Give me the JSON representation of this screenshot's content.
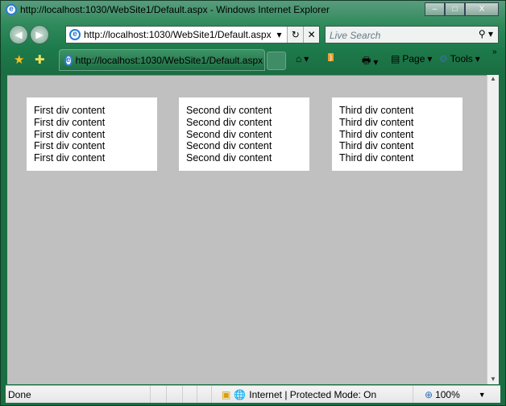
{
  "window": {
    "title": "http://localhost:1030/WebSite1/Default.aspx - Windows Internet Explorer"
  },
  "address_bar": {
    "url": "http://localhost:1030/WebSite1/Default.aspx"
  },
  "search": {
    "placeholder": "Live Search"
  },
  "tab": {
    "label": "http://localhost:1030/WebSite1/Default.aspx"
  },
  "command_bar": {
    "page_label": "Page",
    "tools_label": "Tools"
  },
  "content": {
    "divs": [
      {
        "lines": [
          "First div content",
          "First div content",
          "First div content",
          "First div content",
          "First div content"
        ]
      },
      {
        "lines": [
          "Second div content",
          "Second div content",
          "Second div content",
          "Second div content",
          "Second div content"
        ]
      },
      {
        "lines": [
          "Third div content",
          "Third div content",
          "Third div content",
          "Third div content",
          "Third div content"
        ]
      }
    ]
  },
  "status": {
    "text": "Done",
    "zone": "Internet | Protected Mode: On",
    "zoom": "100%"
  }
}
